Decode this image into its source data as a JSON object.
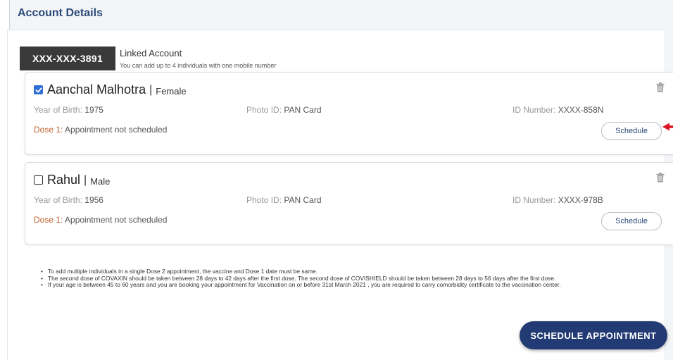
{
  "page": {
    "title": "Account Details"
  },
  "account": {
    "masked_number": "XXX-XXX-3891",
    "linked_label": "Linked Account",
    "subtitle": "You can add up to 4 individuals with one mobile number"
  },
  "beneficiaries": [
    {
      "name": "Aanchal Malhotra",
      "separator": "|",
      "gender": "Female",
      "checked": true,
      "yob_label": "Year of Birth:",
      "yob": "1975",
      "photo_label": "Photo ID:",
      "photo_id": "PAN Card",
      "id_label": "ID Number:",
      "id_number": "XXXX-858N",
      "dose_label": "Dose 1:",
      "dose_status": "Appointment not scheduled",
      "schedule_label": "Schedule"
    },
    {
      "name": "Rahul",
      "separator": "|",
      "gender": "Male",
      "checked": false,
      "yob_label": "Year of Birth:",
      "yob": "1956",
      "photo_label": "Photo ID:",
      "photo_id": "PAN Card",
      "id_label": "ID Number:",
      "id_number": "XXXX-978B",
      "dose_label": "Dose 1:",
      "dose_status": "Appointment not scheduled",
      "schedule_label": "Schedule"
    }
  ],
  "notes": [
    "To add multiple individuals in a single Dose 2 appointment, the vaccine and Dose 1 date must be same.",
    "The second dose of COVAXIN should be taken between 28 days to 42 days after the first dose. The second dose of COVISHIELD should be taken between 28 days to 56 days after the first dose.",
    "If your age is between 45 to 60 years and you are booking your appointment for Vaccination on or before 31st March 2021 , you are required to carry comorbidity certificate to the vaccination center."
  ],
  "actions": {
    "schedule_appointment": "SCHEDULE APPOINTMENT"
  },
  "colors": {
    "title": "#2b4a7a",
    "primary_button": "#233b74",
    "checkbox_checked": "#2f6fd6",
    "dose_label": "#c0602a",
    "annotation_arrow": "#e0141e"
  },
  "icons": {
    "delete": "trash-icon",
    "annotation": "red-arrow-icon"
  }
}
